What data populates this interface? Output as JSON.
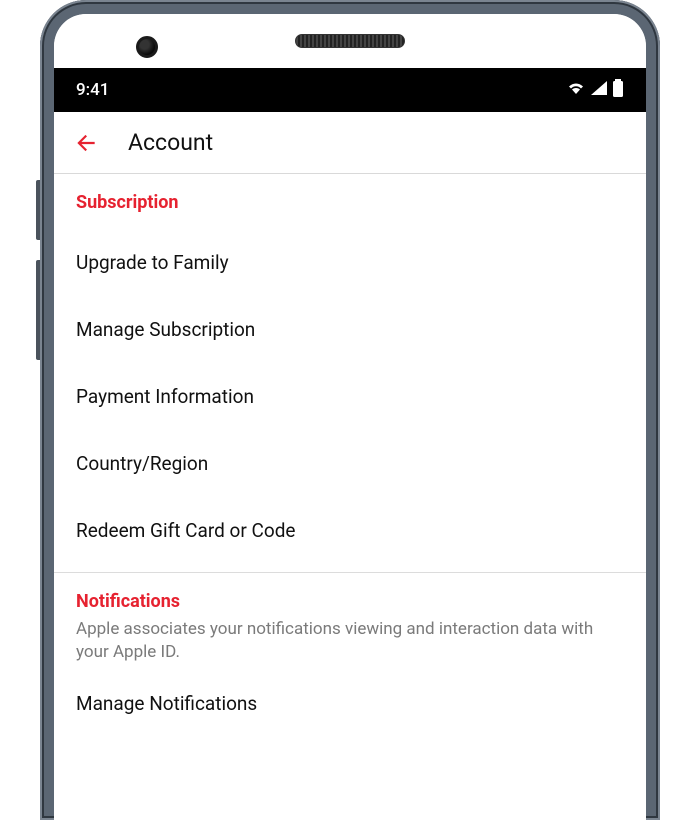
{
  "status": {
    "time": "9:41"
  },
  "header": {
    "title": "Account"
  },
  "sections": {
    "subscription": {
      "title": "Subscription",
      "items": {
        "upgrade": "Upgrade to Family",
        "manage": "Manage Subscription",
        "payment": "Payment Information",
        "country": "Country/Region",
        "redeem": "Redeem Gift Card or Code"
      }
    },
    "notifications": {
      "title": "Notifications",
      "subtitle": "Apple associates your notifications viewing and interaction data with your Apple ID.",
      "items": {
        "manage": "Manage Notifications"
      }
    }
  },
  "colors": {
    "accent": "#e62230",
    "text": "#111111",
    "subtext": "#7a7a7a"
  }
}
